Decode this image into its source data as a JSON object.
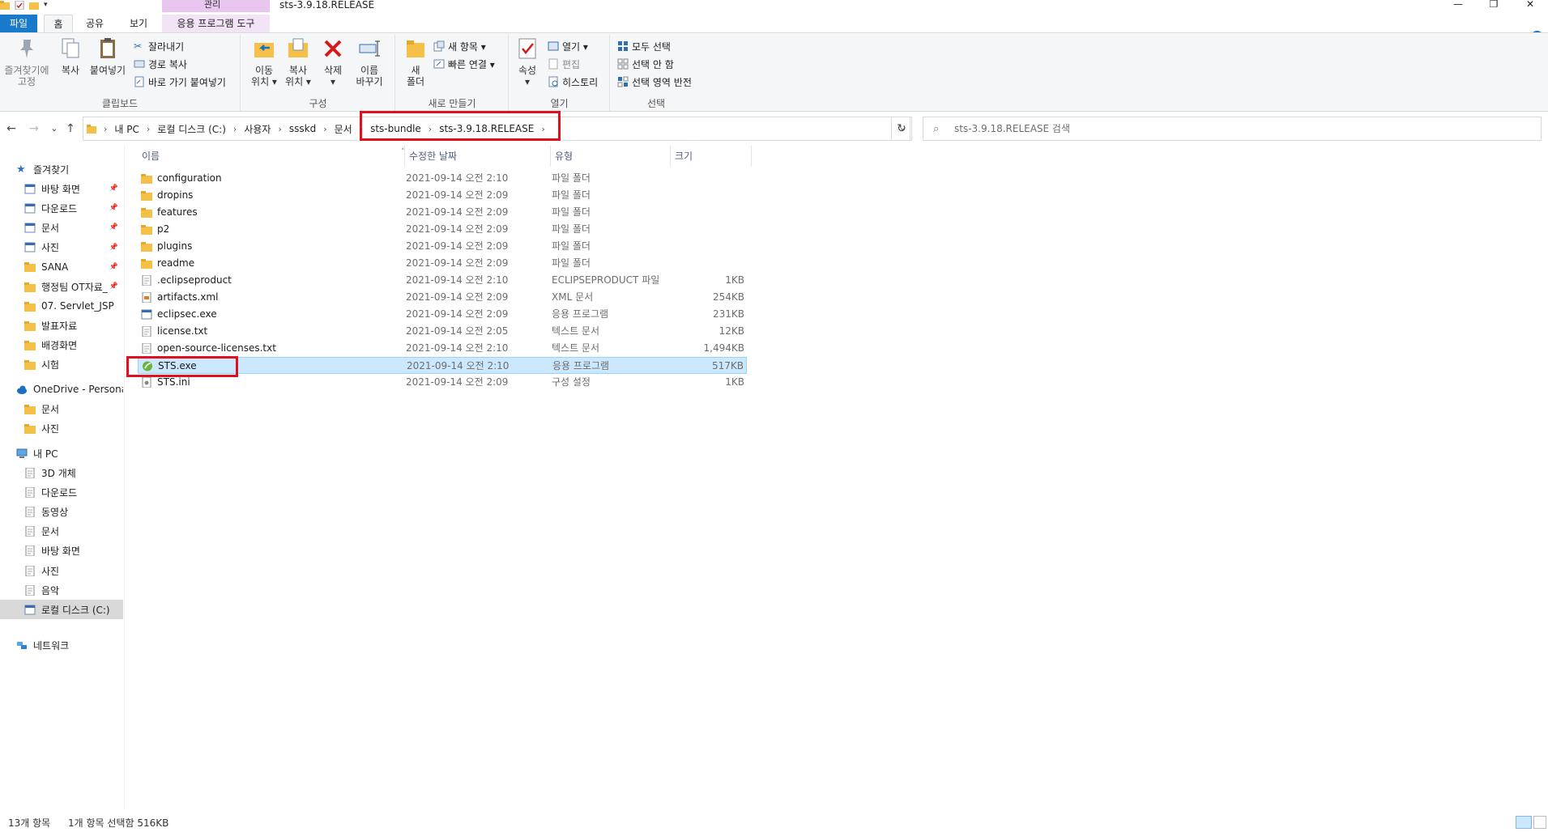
{
  "window": {
    "title": "sts-3.9.18.RELEASE",
    "context_tab_header": "관리",
    "min_symbol": "—",
    "max_symbol": "❐",
    "close_symbol": "✕"
  },
  "tabs": {
    "file": "파일",
    "home": "홈",
    "share": "공유",
    "view": "보기",
    "app_tools": "응용 프로그램 도구"
  },
  "ribbon": {
    "clipboard": {
      "label": "클립보드",
      "pin_quick": "즐겨찾기에\n고정",
      "copy": "복사",
      "paste": "붙여넣기",
      "cut": "잘라내기",
      "copy_path": "경로 복사",
      "paste_shortcut": "바로 가기 붙여넣기"
    },
    "organize": {
      "label": "구성",
      "move_to": "이동\n위치 ▾",
      "copy_to": "복사\n위치 ▾",
      "delete": "삭제\n▾",
      "rename": "이름\n바꾸기"
    },
    "new": {
      "label": "새로 만들기",
      "new_folder": "새\n폴더",
      "new_item": "새 항목 ▾",
      "easy_access": "빠른 연결 ▾"
    },
    "open": {
      "label": "열기",
      "properties": "속성\n▾",
      "open": "열기 ▾",
      "edit": "편집",
      "history": "히스토리"
    },
    "select": {
      "label": "선택",
      "select_all": "모두 선택",
      "select_none": "선택 안 함",
      "invert": "선택 영역 반전"
    }
  },
  "nav": {
    "back": "←",
    "forward": "→",
    "recent": "⌄",
    "up": "↑",
    "dropdown": "⌄",
    "refresh": "↻",
    "breadcrumbs": [
      "내 PC",
      "로컬 디스크 (C:)",
      "사용자",
      "ssskd",
      "문서",
      "sts-bundle",
      "sts-3.9.18.RELEASE"
    ],
    "sep": "›",
    "search_placeholder": "sts-3.9.18.RELEASE 검색",
    "search_icon": "⌕"
  },
  "sidebar": {
    "quick_access": "즐겨찾기",
    "quick_items": [
      {
        "label": "바탕 화면",
        "pinned": true
      },
      {
        "label": "다운로드",
        "pinned": true
      },
      {
        "label": "문서",
        "pinned": true
      },
      {
        "label": "사진",
        "pinned": true
      },
      {
        "label": "SANA",
        "pinned": true
      },
      {
        "label": "행정팀 OT자료_",
        "pinned": true
      },
      {
        "label": "07. Servlet_JSP",
        "pinned": false
      },
      {
        "label": "발표자료",
        "pinned": false
      },
      {
        "label": "배경화면",
        "pinned": false
      },
      {
        "label": "시험",
        "pinned": false
      }
    ],
    "onedrive": "OneDrive - Personal",
    "onedrive_items": [
      "문서",
      "사진"
    ],
    "this_pc": "내 PC",
    "pc_items": [
      "3D 개체",
      "다운로드",
      "동영상",
      "문서",
      "바탕 화면",
      "사진",
      "음악",
      "로컬 디스크 (C:)"
    ],
    "network": "네트워크"
  },
  "columns": {
    "name": "이름",
    "date": "수정한 날짜",
    "type": "유형",
    "size": "크기",
    "sort": "˄"
  },
  "files": [
    {
      "name": "configuration",
      "date": "2021-09-14 오전 2:10",
      "type": "파일 폴더",
      "size": "",
      "kind": "folder"
    },
    {
      "name": "dropins",
      "date": "2021-09-14 오전 2:09",
      "type": "파일 폴더",
      "size": "",
      "kind": "folder"
    },
    {
      "name": "features",
      "date": "2021-09-14 오전 2:09",
      "type": "파일 폴더",
      "size": "",
      "kind": "folder"
    },
    {
      "name": "p2",
      "date": "2021-09-14 오전 2:09",
      "type": "파일 폴더",
      "size": "",
      "kind": "folder"
    },
    {
      "name": "plugins",
      "date": "2021-09-14 오전 2:09",
      "type": "파일 폴더",
      "size": "",
      "kind": "folder"
    },
    {
      "name": "readme",
      "date": "2021-09-14 오전 2:09",
      "type": "파일 폴더",
      "size": "",
      "kind": "folder"
    },
    {
      "name": ".eclipseproduct",
      "date": "2021-09-14 오전 2:10",
      "type": "ECLIPSEPRODUCT 파일",
      "size": "1KB",
      "kind": "file"
    },
    {
      "name": "artifacts.xml",
      "date": "2021-09-14 오전 2:09",
      "type": "XML 문서",
      "size": "254KB",
      "kind": "xml"
    },
    {
      "name": "eclipsec.exe",
      "date": "2021-09-14 오전 2:09",
      "type": "응용 프로그램",
      "size": "231KB",
      "kind": "exe"
    },
    {
      "name": "license.txt",
      "date": "2021-09-14 오전 2:05",
      "type": "텍스트 문서",
      "size": "12KB",
      "kind": "file"
    },
    {
      "name": "open-source-licenses.txt",
      "date": "2021-09-14 오전 2:10",
      "type": "텍스트 문서",
      "size": "1,494KB",
      "kind": "file"
    },
    {
      "name": "STS.exe",
      "date": "2021-09-14 오전 2:10",
      "type": "응용 프로그램",
      "size": "517KB",
      "kind": "sts",
      "selected": true
    },
    {
      "name": "STS.ini",
      "date": "2021-09-14 오전 2:09",
      "type": "구성 설정",
      "size": "1KB",
      "kind": "ini"
    }
  ],
  "status": {
    "count": "13개 항목",
    "selection": "1개 항목 선택함 516KB"
  },
  "colors": {
    "file_tab": "#1979ca",
    "selection": "#cce8ff",
    "highlight_box": "#e0101d",
    "folder": "#f4c048",
    "context_tab": "#e8c6f0"
  }
}
